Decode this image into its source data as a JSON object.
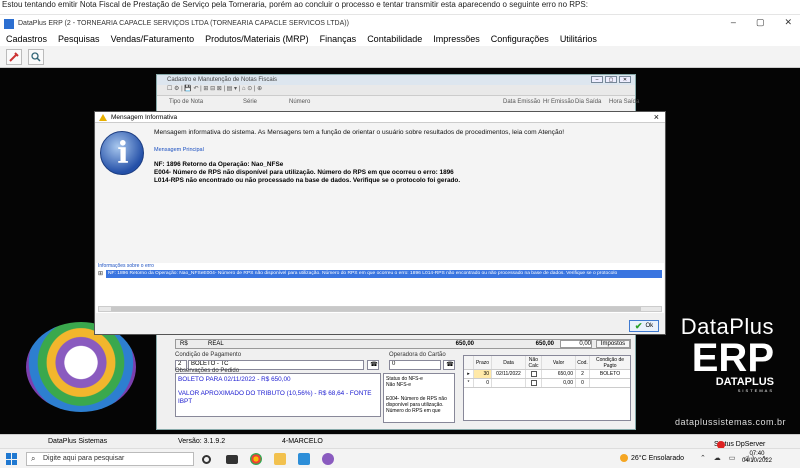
{
  "caption": "Estou tentando emitir Nota Fiscal de Prestação de Serviço pela Torneraria, porém ao concluir o processo e tentar transmitir esta aparecendo o seguinte erro no RPS:",
  "app": {
    "title": "DataPlus ERP (2 - TORNEARIA CAPACLE SERVIÇOS LTDA  (TORNEARIA CAPACLE SERVICOS LTDA))",
    "window_controls": {
      "minimize": "–",
      "maximize": "▢",
      "close": "✕"
    }
  },
  "menu": [
    "Cadastros",
    "Pesquisas",
    "Vendas/Faturamento",
    "Produtos/Materiais (MRP)",
    "Finanças",
    "Contabilidade",
    "Impressões",
    "Configurações",
    "Utilitários"
  ],
  "toolbar": {
    "icons": [
      "tools-icon",
      "magnifier-icon"
    ]
  },
  "notas_window": {
    "title": "Cadastro e Manutenção de Notas Fiscais",
    "toolbar_text": "☐ ⚙ | 💾 ↶ | ⊞ ⊟ ⊠ | ▤ ▾ | ⌂ ⊙ | ⊕",
    "columns": [
      "Tipo de Nota",
      "Série",
      "Número",
      "Data Emissão",
      "Hr Emissão",
      "Dia Saída",
      "Hora Saída"
    ],
    "real_row": {
      "symbol": "R$",
      "label": "REAL",
      "value1": "650,00",
      "value2": "650,00",
      "value3": "0,00",
      "impostos": "Impostos"
    },
    "condicao_label": "Condição de Pagamento",
    "condicao_code": "2",
    "condicao_value": "BOLETO - TC",
    "operadora_label": "Operadora do Cartão",
    "operadora_value": "0",
    "observacoes_label": "Observações do Pedido",
    "observacoes_line1": "BOLETO PARA 02/11/2022 - R$ 650,00",
    "observacoes_line2": "VALOR APROXIMADO DO TRIBUTO (10,56%) - R$ 68,64 - FONTE IBPT",
    "status_label": "Status do NFS-e",
    "status_value": "Não NFS-e",
    "status_error": "E004- Número de RPS não disponível para utilização. Número do RPS em que",
    "grid_headers": [
      "Prazo",
      "Data",
      "Não Calc",
      "Valor",
      "Cod.",
      "Condição de Pagto"
    ],
    "grid_rows": [
      {
        "marker": "▸",
        "prazo": "30",
        "data": "02/11/2022",
        "valor": "650,00",
        "cod": "2",
        "cond": "BOLETO"
      },
      {
        "marker": "*",
        "prazo": "0",
        "data": "",
        "valor": "0,00",
        "cod": "0",
        "cond": ""
      }
    ]
  },
  "dialog": {
    "title": "Mensagem Informativa",
    "main_text": "Mensagem informativa do sistema. As Mensagens tem a função de orientar o usuário sobre resultados de procedimentos, leia com Atenção!",
    "sub_label": "Mensagem Principal",
    "error_line1": "NF: 1896 Retorno da Operação: Nao_NFSe",
    "error_line2": "E004- Número de RPS não disponível para utilização. Número do RPS em que ocorreu o erro: 1896",
    "error_line3": "L014-RPS não encontrado ou não processado na base de dados. Verifique se o protocolo foi gerado.",
    "info_label": "Informações sobre o erro",
    "info_row": "NF: 1896 Retorno da Operação: Nao_NFSeE004- Número de RPS não disponível para utilização. Número do RPS em que ocorreu o erro: 1896 L014-RPS não encontrado ou não processado na base de dados. Verifique se o protocolo",
    "ok_label": "Ok"
  },
  "branding": {
    "line1": "DataPlus",
    "line2": "ERP",
    "company": "DATAPLUS",
    "company_sub": "SISTEMAS",
    "website": "dataplussistemas.com.br"
  },
  "statusbar": {
    "company": "DataPlus Sistemas",
    "version": "Versão: 3.1.9.2",
    "user": "4-MARCELO",
    "server": "Status DpServer"
  },
  "taskbar": {
    "search_placeholder": "Digite aqui para pesquisar",
    "weather": "26°C  Ensolarado",
    "time": "07:40",
    "date": "04/10/2022",
    "tray": "⌃ ☁ ▭ ◁) ∿"
  }
}
